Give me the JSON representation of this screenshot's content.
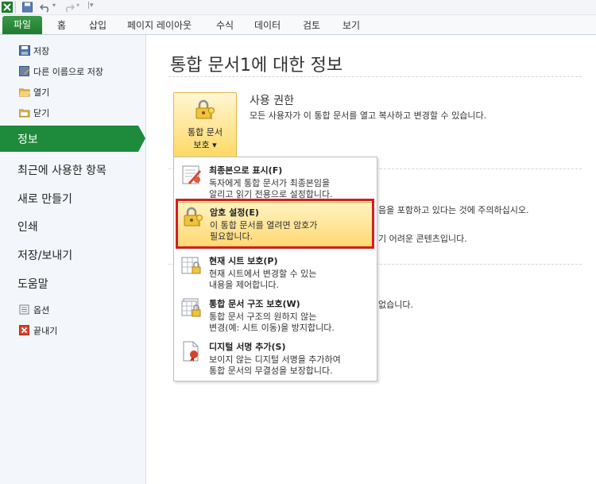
{
  "ribbon": {
    "tabs": [
      "파일",
      "홈",
      "삽입",
      "페이지 레이아웃",
      "수식",
      "데이터",
      "검토",
      "보기"
    ]
  },
  "backstage": {
    "commands": [
      {
        "label": "저장",
        "icon": "save-icon"
      },
      {
        "label": "다른 이름으로 저장",
        "icon": "save-as-icon"
      },
      {
        "label": "열기",
        "icon": "open-folder-icon"
      },
      {
        "label": "닫기",
        "icon": "close-folder-icon"
      }
    ],
    "nav": {
      "info": "정보",
      "recent": "최근에 사용한 항목",
      "new": "새로 만들기",
      "print": "인쇄",
      "save_send": "저장/보내기",
      "help": "도움말"
    },
    "bottom_commands": [
      {
        "label": "옵션",
        "icon": "options-icon"
      },
      {
        "label": "끝내기",
        "icon": "exit-icon"
      }
    ]
  },
  "info": {
    "title": "통합 문서1에 대한 정보",
    "protect_button": {
      "line1": "통합 문서",
      "line2": "보호 ▾"
    },
    "permissions": {
      "title": "사용 권한",
      "description": "모든 사용자가 이 통합 문서를 열고 복사하고 변경할 수 있습니다."
    },
    "partial_text": [
      "음을 포함하고 있다는 것에 주의하십시오.",
      "기 어려운 콘텐츠입니다.",
      "없습니다."
    ]
  },
  "protect_menu": [
    {
      "title": "최종본으로 표시(F)",
      "desc1": "독자에게 통합 문서가 최종본임을",
      "desc2": "알리고 읽기 전용으로 설정합니다.",
      "icon": "mark-final-icon"
    },
    {
      "title": "암호 설정(E)",
      "desc1": "이 통합 문서를 열려면 암호가",
      "desc2": "필요합니다.",
      "icon": "lock-key-icon",
      "highlighted": true
    },
    {
      "title": "현재 시트 보호(P)",
      "desc1": "현재 시트에서 변경할 수 있는",
      "desc2": "내용을 제어합니다.",
      "icon": "sheet-lock-icon"
    },
    {
      "title": "통합 문서 구조 보호(W)",
      "desc1": "통합 문서 구조의 원하지 않는",
      "desc2": "변경(예: 시트 이동)을 방지합니다.",
      "icon": "workbook-lock-icon"
    },
    {
      "title": "디지털 서명 추가(S)",
      "desc1": "보이지 않는 디지털 서명을 추가하여",
      "desc2": "통합 문서의 무결성을 보장합니다.",
      "icon": "signature-icon"
    }
  ],
  "colors": {
    "file_tab": "#1f7b2e",
    "selected_nav": "#1e8a3b",
    "highlight_border": "#d21e22",
    "menu_hover": "#ffd870"
  }
}
